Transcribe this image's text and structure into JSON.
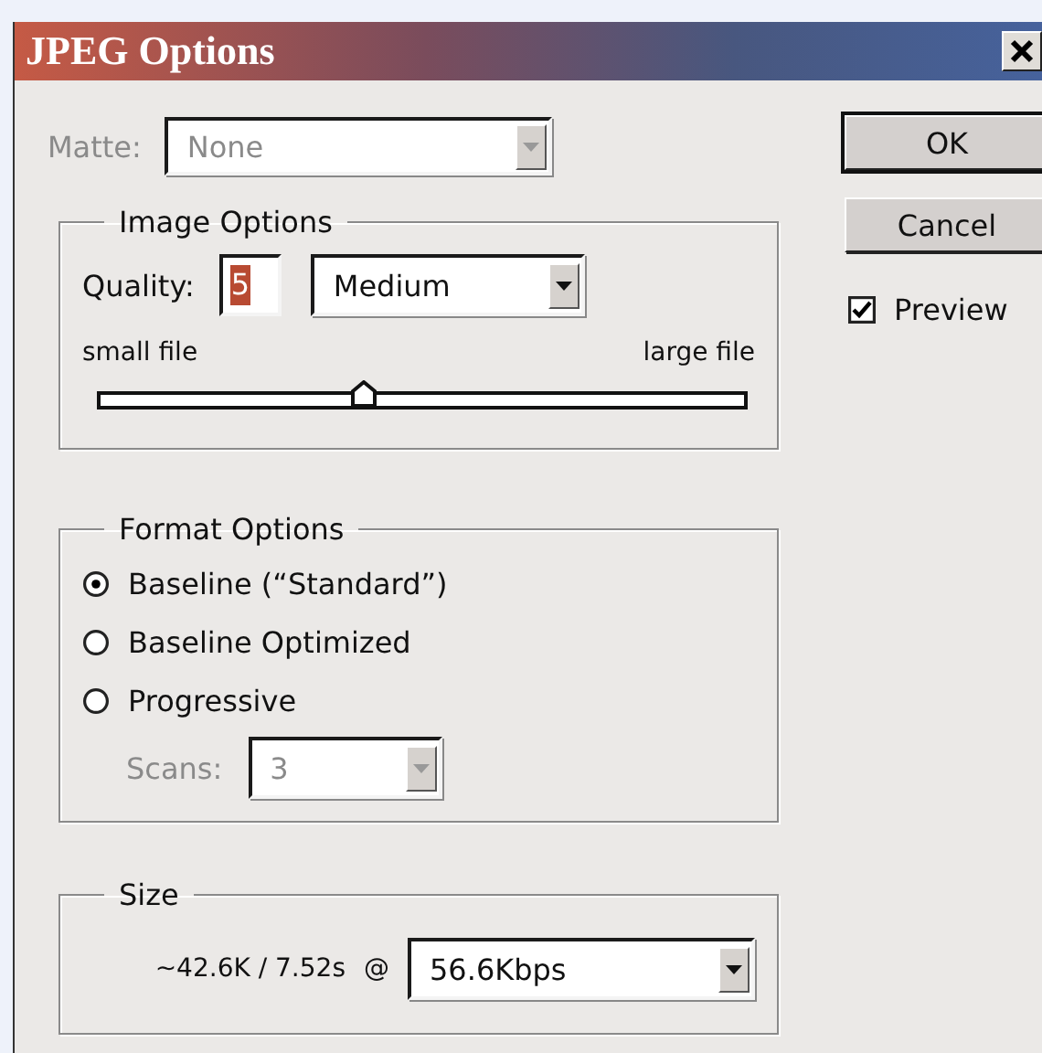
{
  "window": {
    "title": "JPEG Options"
  },
  "matte": {
    "label": "Matte:",
    "value": "None",
    "disabled": true
  },
  "image_options": {
    "title": "Image Options",
    "quality_label": "Quality:",
    "quality_value": "5",
    "quality_value_highlighted": true,
    "quality_preset": "Medium",
    "slider": {
      "min_label": "small file",
      "max_label": "large file",
      "level": 0.41
    }
  },
  "format_options": {
    "title": "Format Options",
    "choices": [
      {
        "label": "Baseline (“Standard”)",
        "selected": true
      },
      {
        "label": "Baseline Optimized",
        "selected": false
      },
      {
        "label": "Progressive",
        "selected": false
      }
    ],
    "scans": {
      "label": "Scans:",
      "value": "3",
      "disabled": true
    }
  },
  "size": {
    "title": "Size",
    "estimate": "~42.6K / 7.52s",
    "at": "@",
    "rate": "56.6Kbps"
  },
  "buttons": [
    {
      "label": "OK",
      "default": true
    },
    {
      "label": "Cancel",
      "default": false
    }
  ],
  "preview": {
    "label": "Preview",
    "checked": true
  }
}
